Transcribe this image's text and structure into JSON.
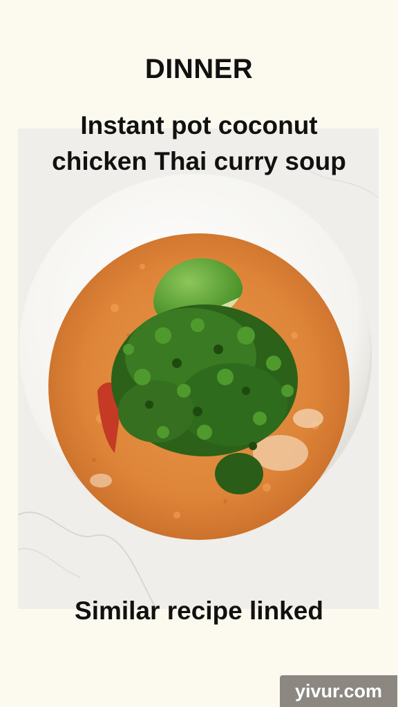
{
  "story": {
    "category": "DINNER",
    "title_line1": "Instant pot coconut",
    "title_line2": "chicken Thai curry soup",
    "caption": "Similar recipe linked",
    "watermark": "yivur.com"
  },
  "photo": {
    "subject": "coconut chicken Thai curry soup in a white bowl topped with cilantro and a lime wedge",
    "colors": {
      "background": "#fcf9ef",
      "marble": "#efeeea",
      "bowl": "#fbfbf9",
      "soup": "#e08a3e",
      "cilantro": "#2f6b1c",
      "lime": "#5fa334"
    }
  }
}
